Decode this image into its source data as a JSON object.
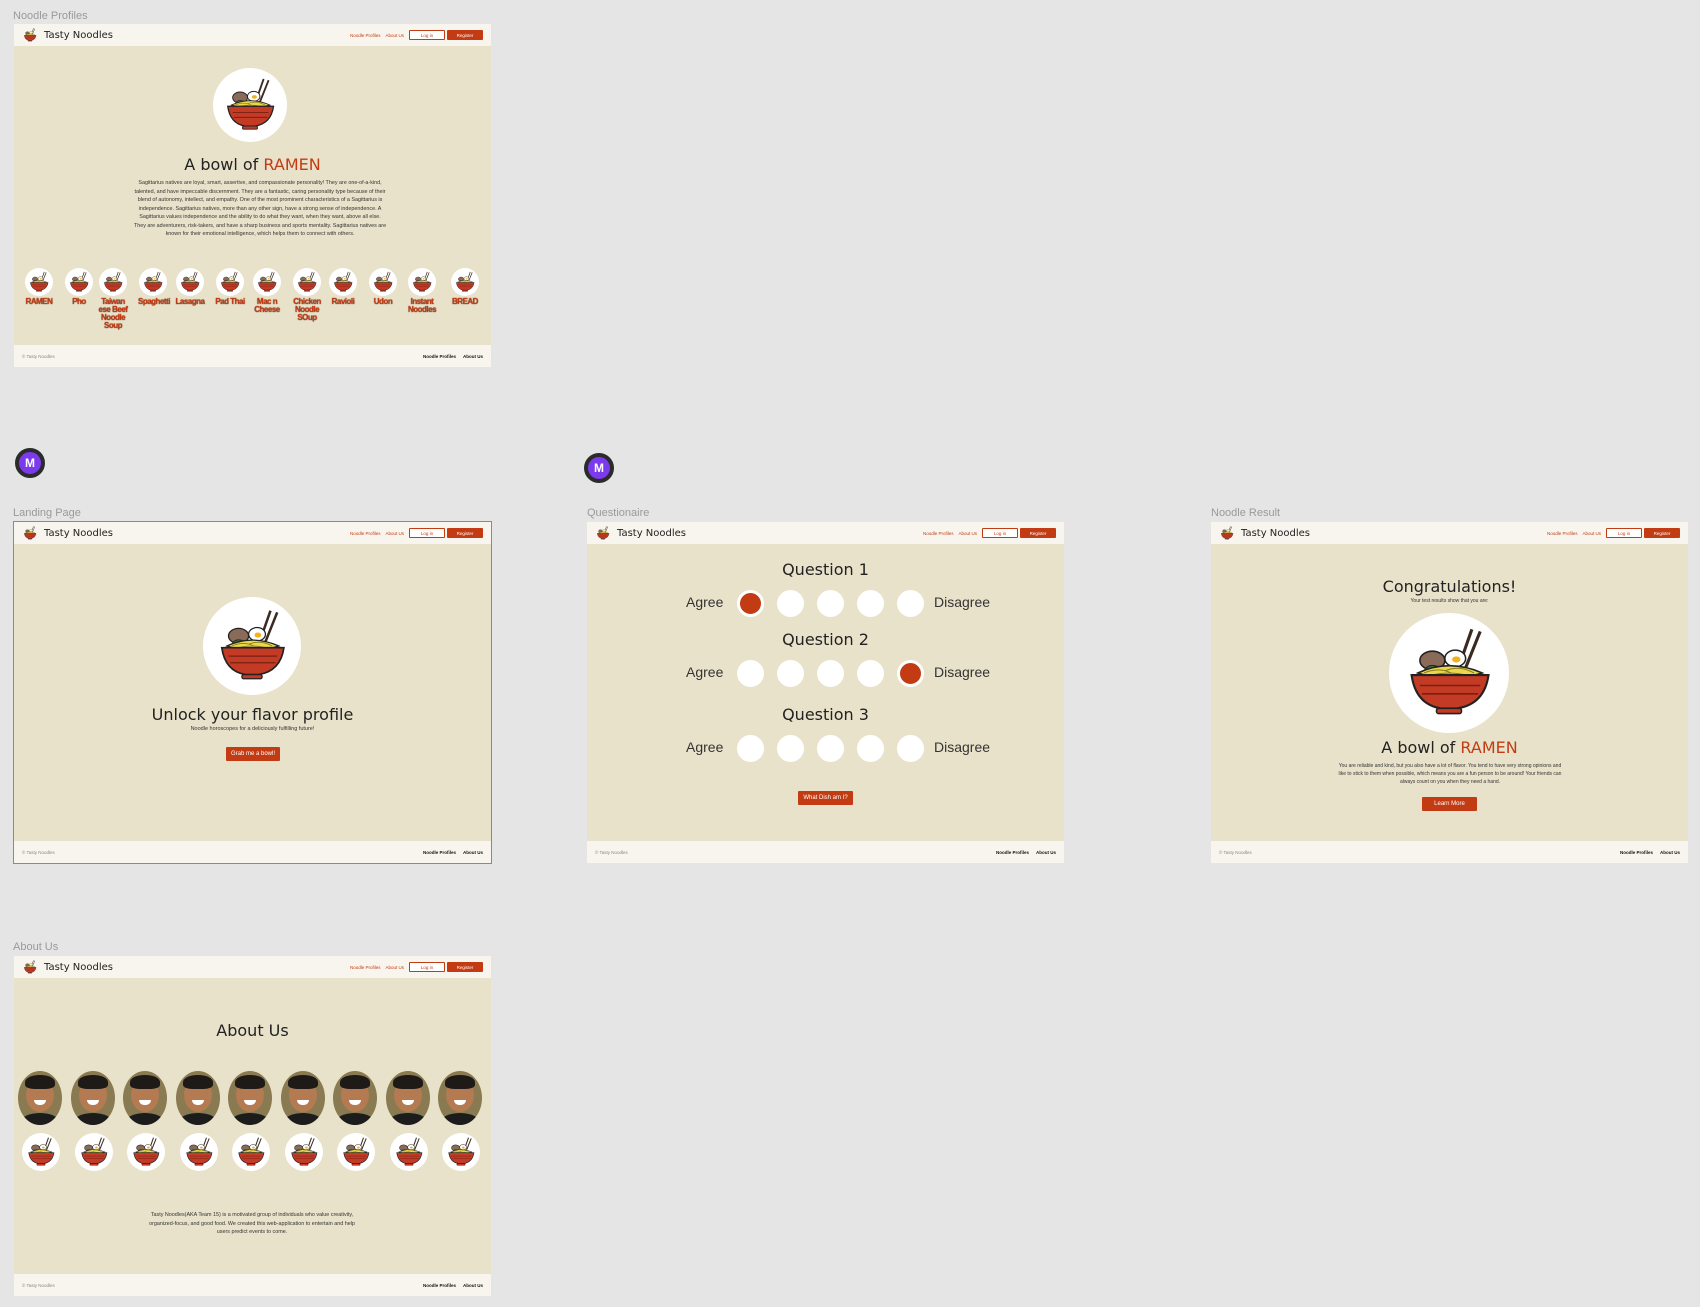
{
  "frames": {
    "profiles": "Noodle Profiles",
    "landing": "Landing Page",
    "questionnaire": "Questionaire",
    "result": "Noodle Result",
    "about": "About Us"
  },
  "nav": {
    "brand": "Tasty Noodles",
    "link_profiles": "Noodle Profiles",
    "link_about": "About Us",
    "login": "Log in",
    "register": "Register"
  },
  "footer": {
    "copyright": "© Tasty Noodles",
    "link_profiles": "Noodle Profiles",
    "link_about": "About Us"
  },
  "badge": {
    "initial": "M"
  },
  "profiles": {
    "title_prefix": "A bowl of",
    "title_dish": "RAMEN",
    "description": "Sagittarius natives are loyal, smart, assertive, and compassionate personality! They are one-of-a-kind, talented, and have impeccable discernment. They are a fantastic, caring personality type because of their blend of autonomy, intellect, and empathy. One of the most prominent characteristics of a Sagittarius is independence. Sagittarius natives, more than any other sign, have a strong sense of independence. A Sagittarius values independence and the ability to do what they want, when they want, above all else. They are adventurers, risk-takers, and have a sharp business and sports mentality. Sagittarius natives are known for their emotional intelligence, which helps them to connect with others.",
    "dishes": [
      "RAMEN",
      "Pho",
      "Taiwan ese Beef Noodle Soup",
      "Spaghetti",
      "Lasagna",
      "Pad Thai",
      "Mac n Cheese",
      "Chicken Noodle SOup",
      "Ravioli",
      "Udon",
      "Instant Noodles",
      "BREAD"
    ]
  },
  "landing": {
    "headline": "Unlock your flavor profile",
    "subhead": "Noodle horoscopes for a deliciously fulfilling future!",
    "cta": "Grab me a bowl!"
  },
  "questionnaire": {
    "agree": "Agree",
    "disagree": "Disagree",
    "questions": [
      {
        "title": "Question 1",
        "selected": 1
      },
      {
        "title": "Question 2",
        "selected": 5
      },
      {
        "title": "Question 3",
        "selected": 0
      }
    ],
    "submit": "What Dish am I?"
  },
  "result": {
    "title": "Congratulations!",
    "subtitle": "Your test results show that you are:",
    "dish_prefix": "A bowl of",
    "dish": "RAMEN",
    "description": "You are reliable and kind, but you also have a lot of flavor. You tend to have very strong opinions and like to stick to them when possible, which means you are a fun person to be around! Your friends can always count on you when they need a hand.",
    "cta": "Learn More"
  },
  "about": {
    "title": "About Us",
    "description": "Tasty Noodles(AKA Team 15) is a motivated group of individuals who value creativity, organized-focus, and good food. We created this web-application to entertain and help users predict events to come."
  },
  "colors": {
    "accent": "#c23b12",
    "frame_bg": "#e9e2ca",
    "nav_bg": "#f8f5ee",
    "canvas": "#e5e5e5",
    "badge": "#7c3aed"
  },
  "icons": [
    "ramen-bowl-icon",
    "ramen-logo-icon"
  ]
}
